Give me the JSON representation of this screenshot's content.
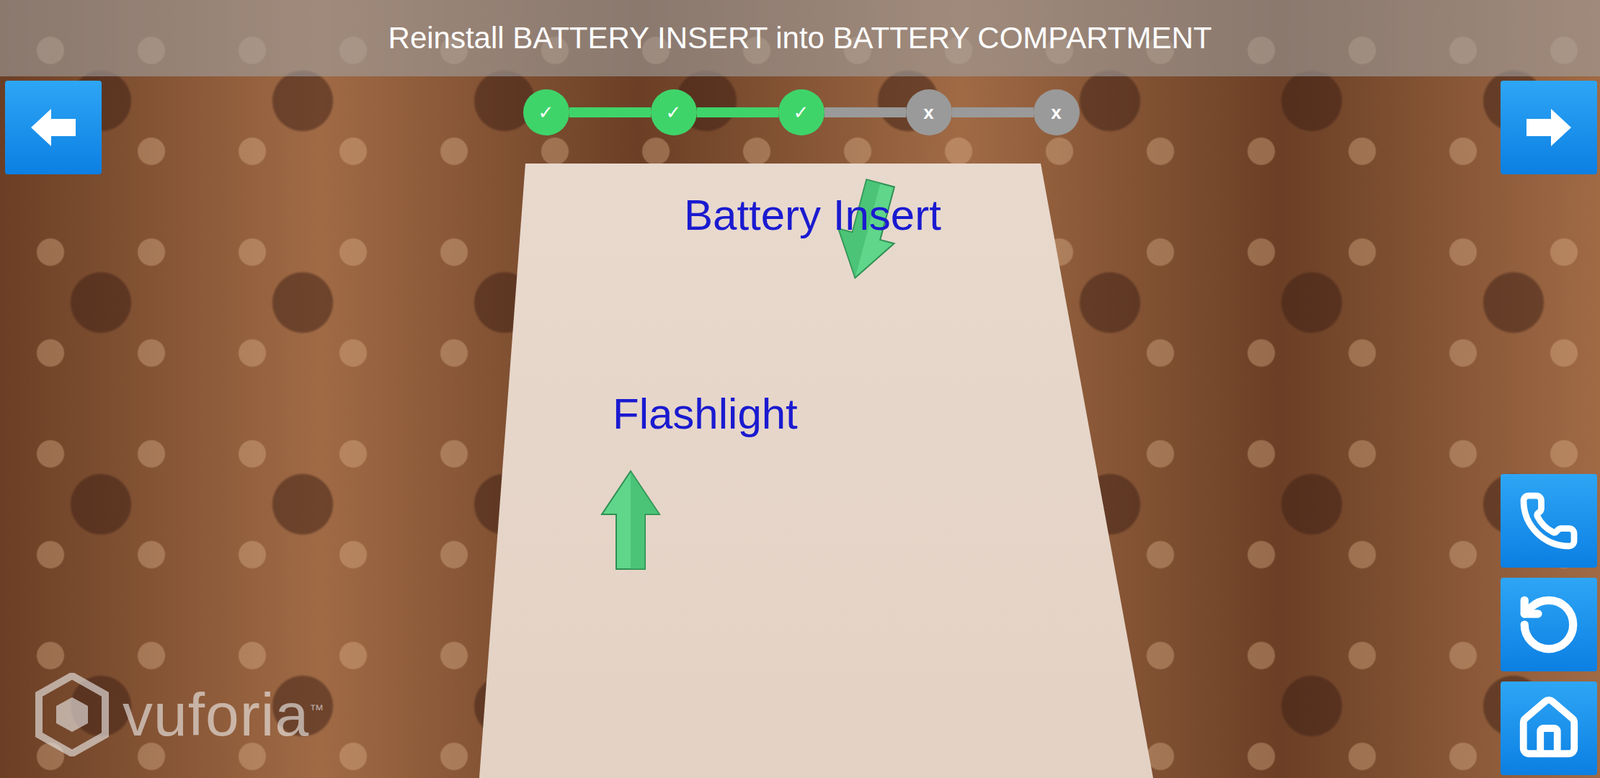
{
  "header": {
    "instruction": "Reinstall BATTERY INSERT into BATTERY COMPARTMENT"
  },
  "steps": [
    {
      "label": "✓",
      "done": true
    },
    {
      "label": "✓",
      "done": true
    },
    {
      "label": "✓",
      "done": true
    },
    {
      "label": "x",
      "done": false
    },
    {
      "label": "x",
      "done": false
    }
  ],
  "ar_labels": [
    {
      "text": "Battery Insert"
    },
    {
      "text": "Flashlight"
    }
  ],
  "watermark": {
    "text": "vuforia",
    "mark": "™"
  }
}
